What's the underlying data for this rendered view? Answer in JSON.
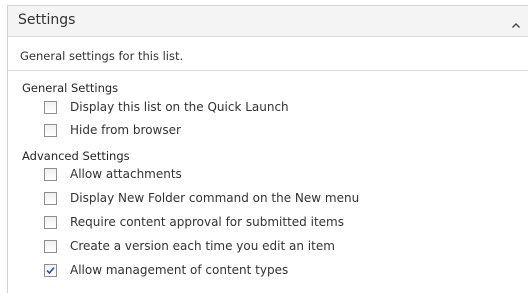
{
  "section": {
    "title": "Settings",
    "description": "General settings for this list."
  },
  "icons": {
    "collapse": "chevron-up-icon",
    "check": "checkmark-icon"
  },
  "groups": [
    {
      "heading": "General Settings",
      "options": [
        {
          "label": "Display this list on the Quick Launch",
          "checked": false
        },
        {
          "label": "Hide from browser",
          "checked": false
        }
      ]
    },
    {
      "heading": "Advanced Settings",
      "options": [
        {
          "label": "Allow attachments",
          "checked": false
        },
        {
          "label": "Display New Folder command on the New menu",
          "checked": false
        },
        {
          "label": "Require content approval for submitted items",
          "checked": false
        },
        {
          "label": "Create a version each time you edit an item",
          "checked": false
        },
        {
          "label": "Allow management of content types",
          "checked": true
        }
      ]
    }
  ],
  "colors": {
    "header_bg": "#f4f4f4",
    "check_color": "#2a4f9c"
  }
}
